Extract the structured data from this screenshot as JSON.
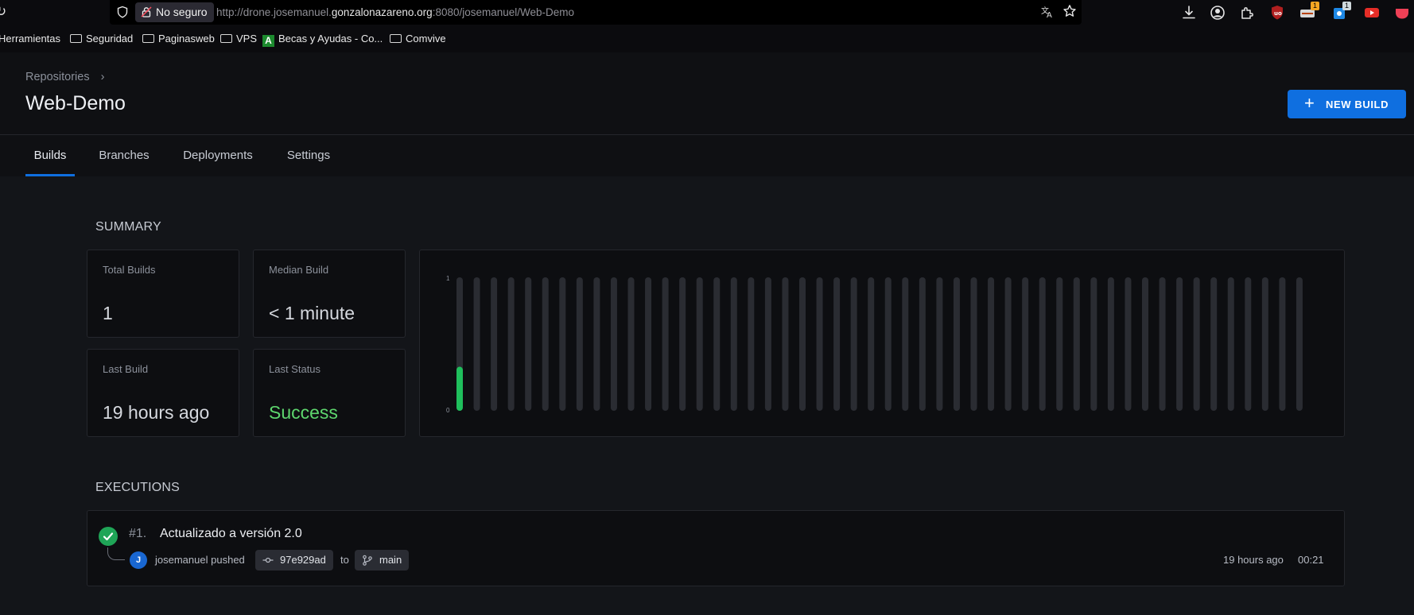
{
  "browser": {
    "not_secure_label": "No seguro",
    "url_prefix": "http://drone.josemanuel.",
    "url_domain": "gonzalonazareno.org",
    "url_suffix": ":8080/josemanuel/Web-Demo",
    "badges": [
      "1",
      "1"
    ],
    "bookmarks": [
      "Herramientas",
      "Seguridad",
      "Paginasweb",
      "VPS",
      "Becas y Ayudas - Co...",
      "Comvive"
    ]
  },
  "header": {
    "breadcrumb": "Repositories",
    "title": "Web-Demo",
    "new_build_label": "NEW BUILD"
  },
  "tabs": [
    "Builds",
    "Branches",
    "Deployments",
    "Settings"
  ],
  "summary": {
    "title": "SUMMARY",
    "total_builds_label": "Total Builds",
    "total_builds_value": "1",
    "median_build_label": "Median Build",
    "median_build_value": "< 1 minute",
    "last_build_label": "Last Build",
    "last_build_value": "19 hours ago",
    "last_status_label": "Last Status",
    "last_status_value": "Success"
  },
  "chart_data": {
    "type": "bar",
    "title": "",
    "xlabel": "",
    "ylabel": "",
    "ylim": [
      0,
      1
    ],
    "y_ticks": [
      "1",
      "0"
    ],
    "slots": 50,
    "values": [
      0.33,
      0,
      0,
      0,
      0,
      0,
      0,
      0,
      0,
      0,
      0,
      0,
      0,
      0,
      0,
      0,
      0,
      0,
      0,
      0,
      0,
      0,
      0,
      0,
      0,
      0,
      0,
      0,
      0,
      0,
      0,
      0,
      0,
      0,
      0,
      0,
      0,
      0,
      0,
      0,
      0,
      0,
      0,
      0,
      0,
      0,
      0,
      0,
      0,
      0
    ],
    "colors": {
      "success": "#1fbf5c",
      "empty": "#2a2c32"
    }
  },
  "executions": {
    "title": "EXECUTIONS",
    "items": [
      {
        "number": "#1.",
        "message": "Actualizado a versión 2.0",
        "avatar_initial": "J",
        "author": "josemanuel",
        "action": "pushed",
        "commit": "97e929ad",
        "to": "to",
        "branch": "main",
        "time_ago": "19 hours ago",
        "duration": "00:21"
      }
    ]
  }
}
